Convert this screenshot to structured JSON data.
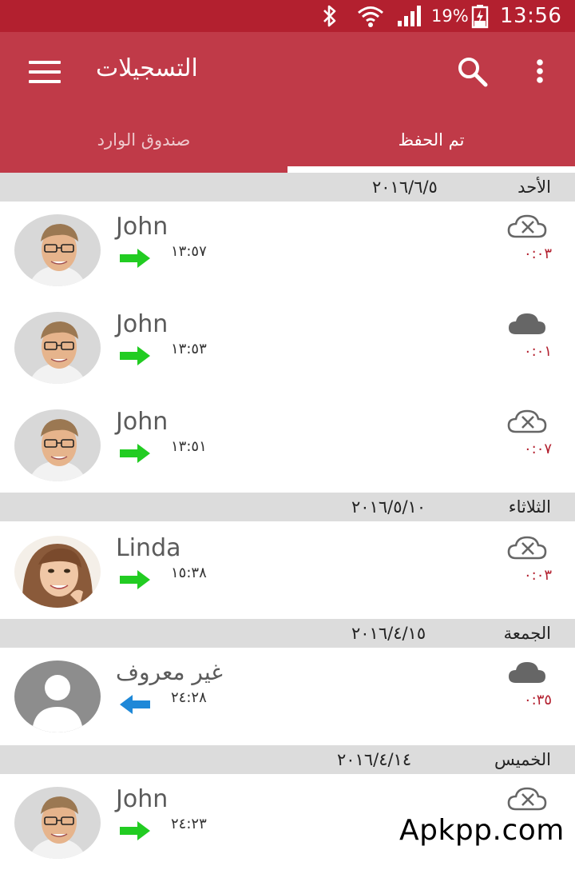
{
  "status_bar": {
    "icons": [
      "bluetooth-icon",
      "wifi-icon",
      "signal-icon",
      "battery-charging-icon"
    ],
    "battery": "19%",
    "time": "13:56",
    "color": "#b3202f"
  },
  "app_bar": {
    "title": "التسجيلات",
    "menu_icon": "hamburger-menu-icon",
    "search_icon": "search-icon",
    "more_icon": "more-vert-icon",
    "color": "#c03a48"
  },
  "tabs": [
    {
      "label": "تم الحفظ",
      "selected": true
    },
    {
      "label": "صندوق الوارد",
      "selected": false
    }
  ],
  "groups": [
    {
      "day": "الأحد",
      "date": "٢٠١٦/٦/٥",
      "calls": [
        {
          "name": "John",
          "time": "١٣:٥٧",
          "direction": "outgoing",
          "duration": "٠:٠٣",
          "cloud": "cloud-off-icon",
          "avatar": "man"
        },
        {
          "name": "John",
          "time": "١٣:٥٣",
          "direction": "outgoing",
          "duration": "٠:٠١",
          "cloud": "cloud-icon",
          "avatar": "man"
        },
        {
          "name": "John",
          "time": "١٣:٥١",
          "direction": "outgoing",
          "duration": "٠:٠٧",
          "cloud": "cloud-off-icon",
          "avatar": "man"
        }
      ]
    },
    {
      "day": "الثلاثاء",
      "date": "٢٠١٦/٥/١٠",
      "calls": [
        {
          "name": "Linda",
          "time": "١٥:٣٨",
          "direction": "outgoing",
          "duration": "٠:٠٣",
          "cloud": "cloud-off-icon",
          "avatar": "woman"
        }
      ]
    },
    {
      "day": "الجمعة",
      "date": "٢٠١٦/٤/١٥",
      "calls": [
        {
          "name": "غير معروف",
          "time": "٢٤:٢٨",
          "direction": "incoming",
          "duration": "٠:٣٥",
          "cloud": "cloud-icon",
          "avatar": "unknown"
        }
      ]
    },
    {
      "day": "الخميس",
      "date": "٢٠١٦/٤/١٤",
      "calls": [
        {
          "name": "John",
          "time": "٢٤:٢٣",
          "direction": "outgoing",
          "duration": "",
          "cloud": "cloud-off-icon",
          "avatar": "man"
        }
      ]
    }
  ],
  "colors": {
    "outgoing_arrow": "#22cc22",
    "incoming_arrow": "#1e88d8",
    "duration_text": "#b3202f"
  },
  "watermark": "Apkpp.com"
}
